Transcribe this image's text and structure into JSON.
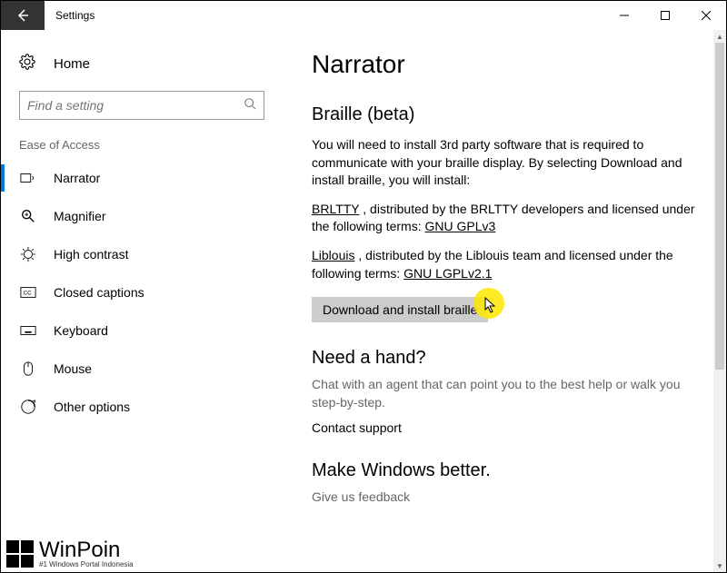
{
  "titlebar": {
    "title": "Settings"
  },
  "sidebar": {
    "home_label": "Home",
    "search_placeholder": "Find a setting",
    "category": "Ease of Access",
    "items": [
      {
        "label": "Narrator"
      },
      {
        "label": "Magnifier"
      },
      {
        "label": "High contrast"
      },
      {
        "label": "Closed captions"
      },
      {
        "label": "Keyboard"
      },
      {
        "label": "Mouse"
      },
      {
        "label": "Other options"
      }
    ]
  },
  "main": {
    "title": "Narrator",
    "braille_heading": "Braille (beta)",
    "braille_intro": "You will need to install 3rd party software that is required to communicate with your braille display. By selecting Download and install braille, you will install:",
    "brltty_link": "BRLTTY",
    "brltty_text_after": " , distributed by the BRLTTY developers and licensed under the following terms: ",
    "gnu_gpl_link": "GNU GPLv3",
    "liblouis_link": "Liblouis",
    "liblouis_text_after": " , distributed by the Liblouis team and licensed under the following terms: ",
    "gnu_lgpl_link": "GNU LGPLv2.1",
    "download_button": "Download and install braille",
    "need_hand_heading": "Need a hand?",
    "need_hand_text": "Chat with an agent that can point you to the best help or walk you step-by-step.",
    "contact_support": "Contact support",
    "make_better_heading": "Make Windows better.",
    "feedback": "Give us feedback"
  },
  "watermark": {
    "brand": "WinPoin",
    "tagline": "#1 Windows Portal Indonesia"
  }
}
